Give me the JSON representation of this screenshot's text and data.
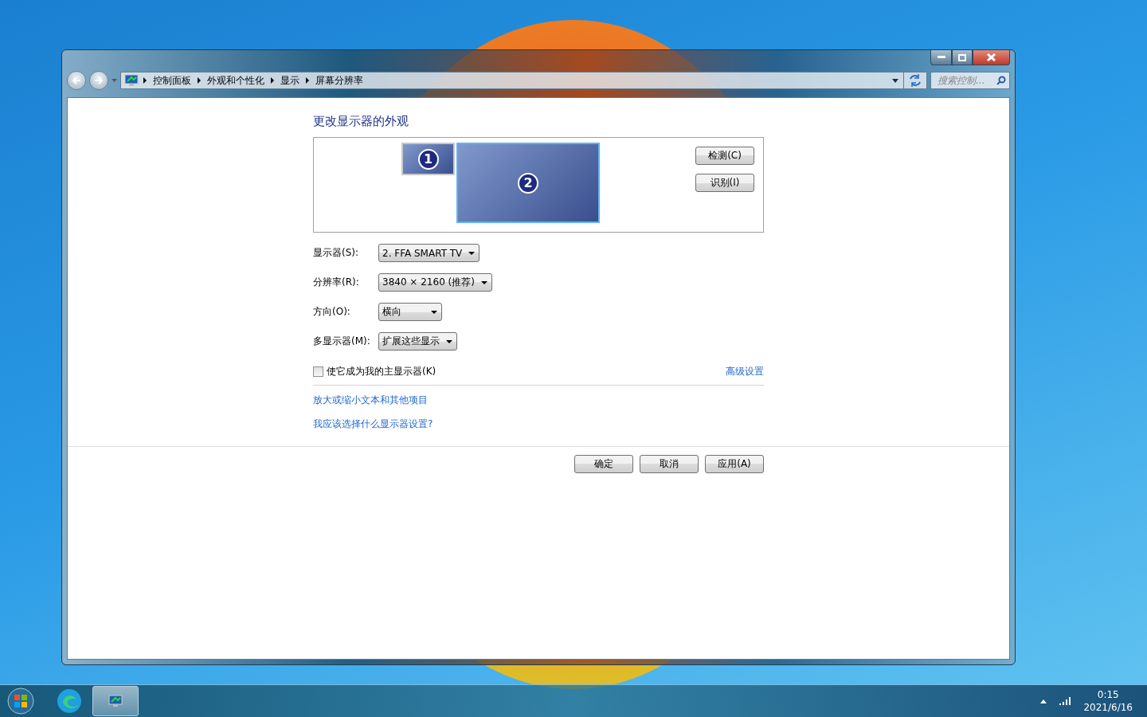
{
  "breadcrumb": [
    "控制面板",
    "外观和个性化",
    "显示",
    "屏幕分辨率"
  ],
  "search": {
    "placeholder": "搜索控制..."
  },
  "heading": "更改显示器的外观",
  "monitors": [
    {
      "label": "1",
      "selected": false
    },
    {
      "label": "2",
      "selected": true
    }
  ],
  "side_buttons": [
    "检测(C)",
    "识别(I)"
  ],
  "fields": [
    {
      "label": "显示器(S):",
      "value": "2. FFA SMART TV"
    },
    {
      "label": "分辨率(R):",
      "value": "3840 × 2160 (推荐)"
    },
    {
      "label": "方向(O):",
      "value": "横向"
    },
    {
      "label": "多显示器(M):",
      "value": "扩展这些显示"
    }
  ],
  "primary_checkbox": {
    "label": "使它成为我的主显示器(K)",
    "checked": false
  },
  "advanced_link": "高级设置",
  "links": [
    "放大或缩小文本和其他项目",
    "我应该选择什么显示器设置?"
  ],
  "dialog_buttons": [
    "确定",
    "取消",
    "应用(A)"
  ],
  "taskbar_apps": [
    {
      "kind": "browser",
      "selected": false
    },
    {
      "kind": "display",
      "selected": true
    }
  ],
  "clock": {
    "time": "0:15",
    "date": "2021/6/16"
  }
}
